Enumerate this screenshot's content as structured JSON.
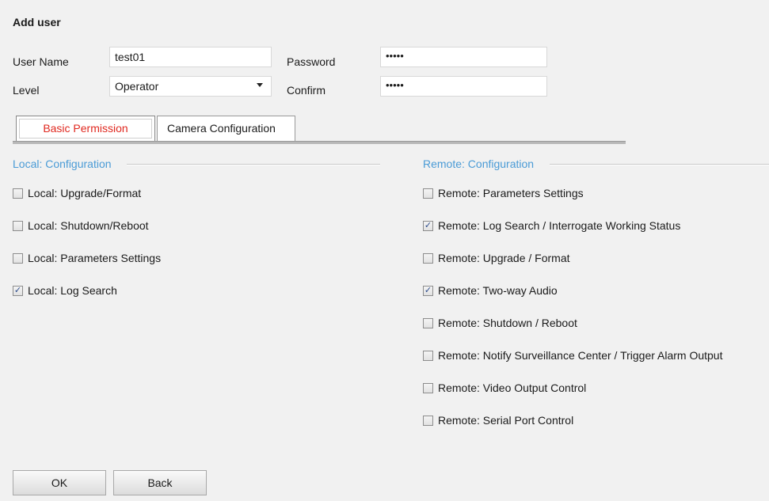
{
  "header": {
    "title": "Add user"
  },
  "form": {
    "username_label": "User Name",
    "username_value": "test01",
    "password_label": "Password",
    "password_value": "•••••",
    "level_label": "Level",
    "level_value": "Operator",
    "confirm_label": "Confirm",
    "confirm_value": "•••••"
  },
  "tabs": [
    {
      "label": "Basic Permission",
      "active": true
    },
    {
      "label": "Camera Configuration",
      "active": false
    }
  ],
  "local": {
    "section_title": "Local: Configuration",
    "items": [
      {
        "label": "Local: Upgrade/Format",
        "checked": false
      },
      {
        "label": "Local: Shutdown/Reboot",
        "checked": false
      },
      {
        "label": "Local: Parameters Settings",
        "checked": false
      },
      {
        "label": "Local: Log Search",
        "checked": true
      }
    ]
  },
  "remote": {
    "section_title": "Remote: Configuration",
    "items": [
      {
        "label": "Remote: Parameters Settings",
        "checked": false
      },
      {
        "label": "Remote: Log Search / Interrogate Working Status",
        "checked": true
      },
      {
        "label": "Remote: Upgrade / Format",
        "checked": false
      },
      {
        "label": "Remote: Two-way Audio",
        "checked": true
      },
      {
        "label": "Remote: Shutdown / Reboot",
        "checked": false
      },
      {
        "label": "Remote: Notify Surveillance Center / Trigger Alarm Output",
        "checked": false
      },
      {
        "label": "Remote: Video Output Control",
        "checked": false
      },
      {
        "label": "Remote: Serial Port Control",
        "checked": false
      }
    ]
  },
  "buttons": {
    "ok": "OK",
    "back": "Back"
  },
  "colors": {
    "section_title": "#4a9bd6",
    "active_tab": "#e0281f"
  }
}
